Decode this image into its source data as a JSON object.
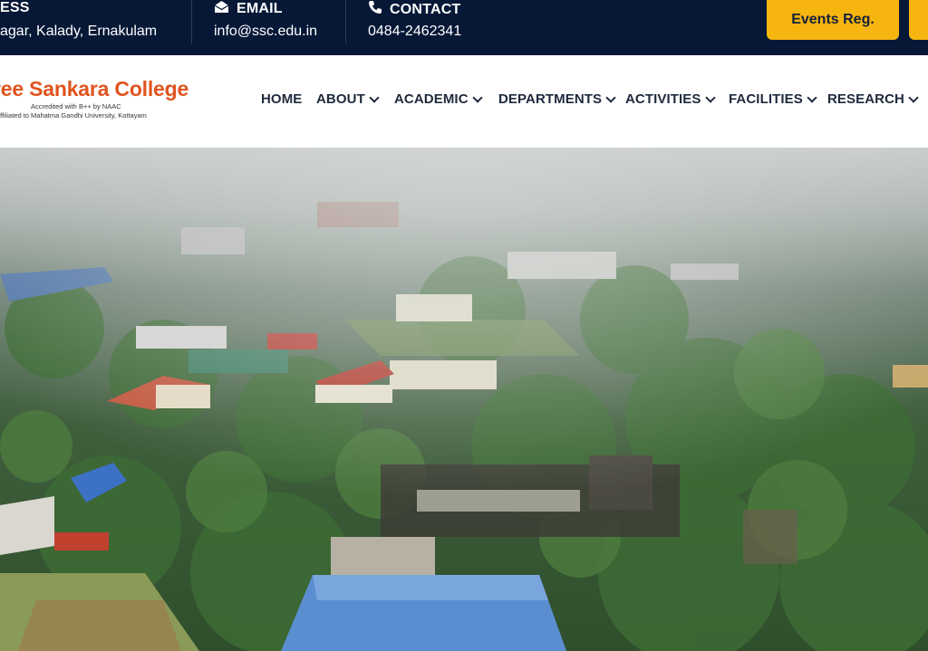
{
  "topbar": {
    "address": {
      "title": "ESS",
      "value": "agar, Kalady, Ernakulam"
    },
    "email": {
      "title": "EMAIL",
      "value": "info@ssc.edu.in"
    },
    "contact": {
      "title": "CONTACT",
      "value": "0484-2462341"
    },
    "events_button": "Events Reg."
  },
  "logo": {
    "title": "ree Sankara College",
    "accreditation": "Accredited with B++ by NAAC",
    "affiliation": "ffiliated to Mahatma Gandhi University, Kottayam"
  },
  "nav": [
    {
      "label": "HOME",
      "dropdown": false
    },
    {
      "label": "ABOUT",
      "dropdown": true
    },
    {
      "label": "ACADEMIC",
      "dropdown": true
    },
    {
      "label": "DEPARTMENTS",
      "dropdown": true
    },
    {
      "label": "ACTIVITIES",
      "dropdown": true
    },
    {
      "label": "FACILITIES",
      "dropdown": true
    },
    {
      "label": "RESEARCH",
      "dropdown": true
    }
  ],
  "colors": {
    "topbar_bg": "#061836",
    "accent": "#f7b50f",
    "logo_orange": "#e0541e"
  },
  "hero": {
    "icon": "aerial-campus-photo"
  }
}
